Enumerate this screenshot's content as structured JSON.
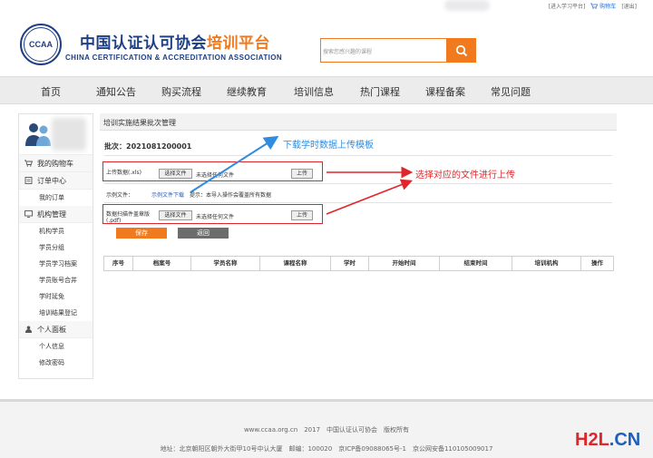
{
  "toplinks": {
    "study_platform": "[进入学习平台]",
    "cart": "购物车",
    "logout": "[退出]"
  },
  "header": {
    "logo_emblem_text": "CCAA",
    "logo_cn_main": "中国认证认可协会",
    "logo_cn_accent": "培训平台",
    "logo_en": "CHINA CERTIFICATION & ACCREDITATION ASSOCIATION",
    "search_placeholder": "搜索您感兴趣的课程"
  },
  "nav": {
    "items": [
      "首页",
      "通知公告",
      "购买流程",
      "继续教育",
      "培训信息",
      "热门课程",
      "课程备案",
      "常见问题"
    ]
  },
  "sidebar": {
    "cart": "我的购物车",
    "orders": {
      "label": "订单中心",
      "items": [
        "我的订单"
      ]
    },
    "org": {
      "label": "机构管理",
      "items": [
        "机构学员",
        "学员分组",
        "学员学习档案",
        "学员账号合并",
        "学时延免",
        "培训结果登记"
      ]
    },
    "personal": {
      "label": "个人面板",
      "items": [
        "个人信息",
        "修改密码"
      ]
    }
  },
  "main": {
    "title": "培训实施结果批次管理",
    "batch_label": "批次：",
    "batch_no": "2021081200001",
    "row1": {
      "label": "上传数据(.xls)",
      "choose": "选择文件",
      "no_file": "未选择任何文件",
      "upload": "上传"
    },
    "sample": {
      "label": "示例文件：",
      "link": "示例文件下载",
      "tip": "提示：本导入操作会覆盖所有数据"
    },
    "row2": {
      "label": "数据扫描件盖章版(.pdf)",
      "choose": "选择文件",
      "no_file": "未选择任何文件",
      "upload": "上传"
    },
    "save": "保存",
    "back": "返回",
    "table_headers": [
      "序号",
      "档案号",
      "学员名称",
      "课程名称",
      "学时",
      "开始时间",
      "结束时间",
      "培训机构",
      "操作"
    ]
  },
  "annotations": {
    "blue": "下载学时数据上传模板",
    "red": "选择对应的文件进行上传"
  },
  "footer": {
    "line1": "www.ccaa.org.cn　2017　中国认证认可协会　版权所有",
    "line2": "地址：北京朝阳区朝外大街甲10号中认大厦　邮编：100020　京ICP备09088065号-1　京公网安备110105009017"
  },
  "watermark": {
    "part1": "H2L",
    "part2": ".CN"
  }
}
